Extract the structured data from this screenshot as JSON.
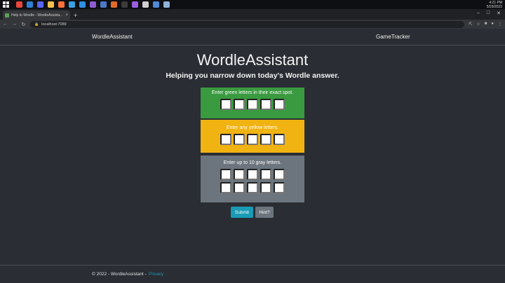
{
  "taskbar": {
    "clock_time": "4:21 PM",
    "clock_date": "5/29/2022",
    "apps": [
      {
        "name": "chrome-icon",
        "color": "#e8453c"
      },
      {
        "name": "check-icon",
        "color": "#2d7fd3"
      },
      {
        "name": "discord-icon",
        "color": "#5865f2"
      },
      {
        "name": "file-explorer-icon",
        "color": "#f2c14e"
      },
      {
        "name": "firefox-icon",
        "color": "#ff7139"
      },
      {
        "name": "app-icon",
        "color": "#3aa0e0"
      },
      {
        "name": "vscode-icon",
        "color": "#2f8fe0"
      },
      {
        "name": "visual-studio-icon",
        "color": "#8e5bd3"
      },
      {
        "name": "github-icon",
        "color": "#4a7ac9"
      },
      {
        "name": "git-icon",
        "color": "#e06a2c"
      },
      {
        "name": "terminal-icon",
        "color": "#3b3b3b"
      },
      {
        "name": "vs-icon",
        "color": "#9b5fe0"
      },
      {
        "name": "app-window-icon",
        "color": "#cfcfcf"
      },
      {
        "name": "chat-icon",
        "color": "#4f8ad9"
      },
      {
        "name": "settings-icon",
        "color": "#8fb3d9"
      }
    ]
  },
  "browser": {
    "tab_title": "Help to Wordle - WordleAssista...",
    "tab_close": "×",
    "new_tab": "+",
    "address": "localhost:7089"
  },
  "nav": {
    "brand": "WordleAssistant",
    "link": "GameTracker"
  },
  "main": {
    "title": "WordleAssistant",
    "subtitle": "Helping you narrow down today's Wordle answer.",
    "green_label": "Enter green letters in their exact spot.",
    "yellow_label": "Enter any yellow letters.",
    "gray_label": "Enter up to 10 gray letters.",
    "submit_label": "Submit",
    "hint_label": "Hint?"
  },
  "footer": {
    "copyright": "© 2022 - WordleAssistant -",
    "privacy": "Privacy"
  },
  "colors": {
    "green": "#3a9a3f",
    "yellow": "#f1b312",
    "gray": "#6c757d",
    "accent": "#1a9bb5"
  }
}
